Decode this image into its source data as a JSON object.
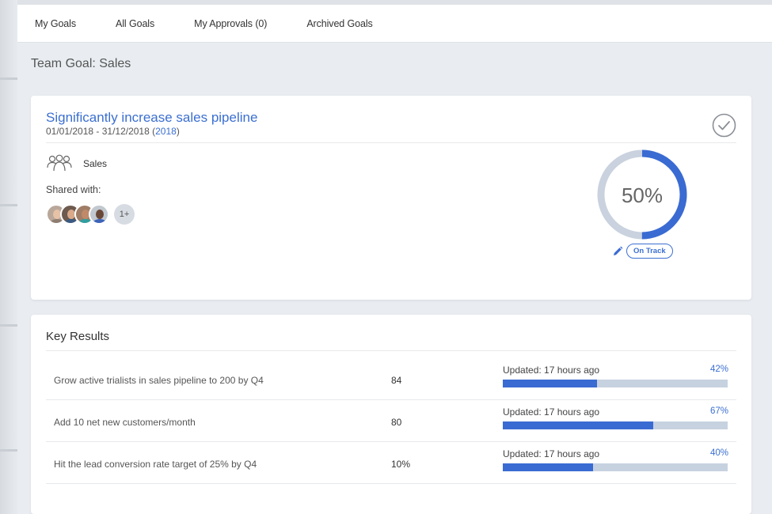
{
  "nav": {
    "tabs": [
      {
        "label": "My Goals"
      },
      {
        "label": "All Goals"
      },
      {
        "label": "My Approvals (0)"
      },
      {
        "label": "Archived Goals"
      }
    ]
  },
  "page": {
    "title": "Team Goal: Sales"
  },
  "goal": {
    "title": "Significantly increase sales pipeline",
    "date_range": "01/01/2018 - 31/12/2018",
    "year_open": " (",
    "year": "2018",
    "year_close": ")",
    "team_label": "Sales",
    "shared_label": "Shared with:",
    "shared_more": "1+",
    "progress_text": "50%",
    "progress_fraction": 0.5,
    "status": "On Track"
  },
  "key_results": {
    "title": "Key Results",
    "rows": [
      {
        "name": "Grow active trialists in sales pipeline to 200 by Q4",
        "value": "84",
        "updated": "Updated: 17 hours ago",
        "pct": "42%",
        "fraction": 0.42
      },
      {
        "name": "Add 10 net new customers/month",
        "value": "80",
        "updated": "Updated: 17 hours ago",
        "pct": "67%",
        "fraction": 0.67
      },
      {
        "name": "Hit the lead conversion rate target of 25% by Q4",
        "value": "10%",
        "updated": "Updated: 17 hours ago",
        "pct": "40%",
        "fraction": 0.4
      }
    ]
  },
  "colors": {
    "accent": "#3b6fd1",
    "bar_track": "#c7d2e0",
    "donut_track": "#c9d2de"
  },
  "icons": {
    "complete": "check-circle-icon",
    "team": "team-icon",
    "edit": "pencil-icon"
  }
}
